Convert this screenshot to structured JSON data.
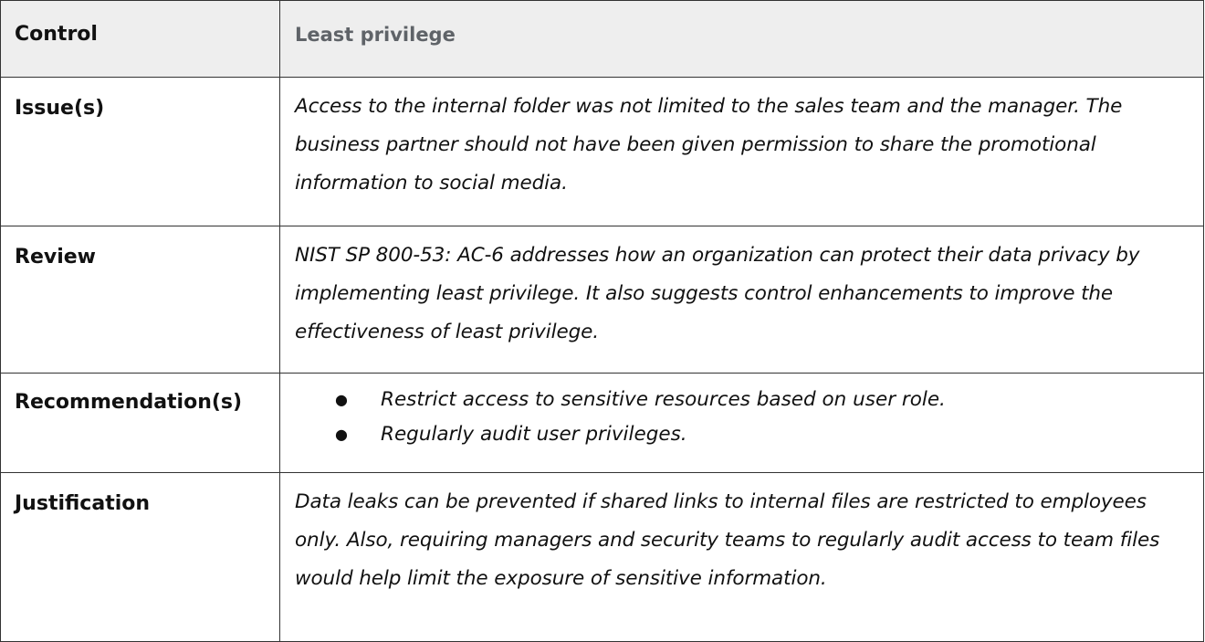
{
  "table": {
    "header": {
      "label": "Control",
      "value": "Least privilege"
    },
    "issues": {
      "label": "Issue(s)",
      "text": "Access to the internal folder was not limited to the sales team and the manager. The business partner should not have been given permission to share the promotional information to social media."
    },
    "review": {
      "label": "Review",
      "text": "NIST SP 800-53: AC-6 addresses how an organization can protect their data privacy by implementing least privilege. It also suggests control enhancements to improve the effectiveness of least privilege."
    },
    "recommendations": {
      "label": "Recommendation(s)",
      "bullet_glyph": "●",
      "items": [
        "Restrict access to sensitive resources based on user role.",
        "Regularly audit user privileges."
      ]
    },
    "justification": {
      "label": "Justification",
      "text": "Data leaks can be prevented if shared links to internal files are restricted to employees only. Also, requiring managers and security teams to regularly audit access to team files would help limit the exposure of sensitive information."
    }
  }
}
